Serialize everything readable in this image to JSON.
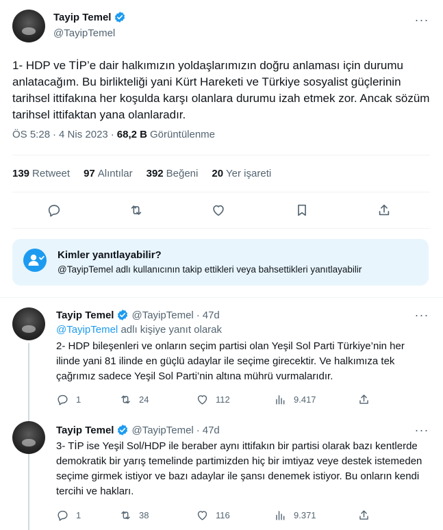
{
  "main_tweet": {
    "display_name": "Tayip Temel",
    "handle": "@TayipTemel",
    "text": "1- HDP ve TİP’e dair halkımızın yoldaşlarımızın doğru anlaması için durumu anlatacağım. Bu birlikteliği yani Kürt Hareketi ve Türkiye sosyalist güçlerinin tarihsel ittifakına her koşulda karşı olanlara durumu izah etmek zor. Ancak sözüm tarihsel ittifaktan yana olanlaradır.",
    "time": "ÖS 5:28",
    "date": "4 Nis 2023",
    "views_count": "68,2 B",
    "views_label": "Görüntülenme",
    "stats": {
      "retweets_count": "139",
      "retweets_label": "Retweet",
      "quotes_count": "97",
      "quotes_label": "Alıntılar",
      "likes_count": "392",
      "likes_label": "Beğeni",
      "bookmarks_count": "20",
      "bookmarks_label": "Yer işareti"
    },
    "icons": [
      "reply-icon",
      "retweet-icon",
      "like-icon",
      "bookmark-icon",
      "share-icon"
    ]
  },
  "reply_restriction": {
    "title": "Kimler yanıtlayabilir?",
    "subtitle": "@TayipTemel adlı kullanıcının takip ettikleri veya bahsettikleri yanıtlayabilir",
    "icon": "people-icon"
  },
  "replies": [
    {
      "display_name": "Tayip Temel",
      "handle": "@TayipTemel",
      "time": "47d",
      "replying_mention": "@TayipTemel",
      "replying_suffix": "adlı kişiye yanıt olarak",
      "text": "2- HDP bileşenleri ve onların seçim partisi olan Yeşil Sol Parti Türkiye’nin her ilinde yani 81 ilinde en güçlü adaylar ile seçime girecektir. Ve halkımıza tek çağrımız sadece Yeşil Sol Parti’nin altına mührü vurmalarıdır.",
      "replies": "1",
      "retweets": "24",
      "likes": "112",
      "views": "9.417"
    },
    {
      "display_name": "Tayip Temel",
      "handle": "@TayipTemel",
      "time": "47d",
      "text": "3- TİP ise Yeşil Sol/HDP ile beraber aynı ittifakın bir partisi olarak bazı kentlerde demokratik bir yarış temelinde partimizden hiç bir imtiyaz veye destek istemeden seçime girmek istiyor ve bazı adaylar ile şansı denemek istiyor. Bu onların kendi tercihi ve hakları.",
      "replies": "1",
      "retweets": "38",
      "likes": "116",
      "views": "9.371"
    }
  ],
  "colors": {
    "accent": "#1d9bf0",
    "text": "#0f1419",
    "secondary": "#536471",
    "info_bg": "#e8f5fd"
  }
}
